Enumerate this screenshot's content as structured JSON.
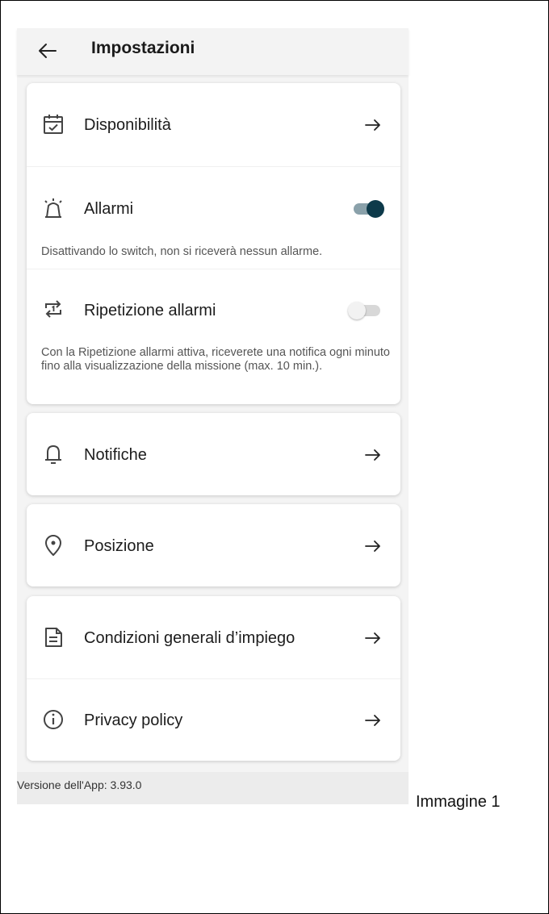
{
  "header": {
    "title": "Impostazioni",
    "back_icon": "arrow-left-icon"
  },
  "settings": {
    "availability": {
      "label": "Disponibilità",
      "icon": "calendar-check-icon"
    },
    "alarms": {
      "label": "Allarmi",
      "icon": "alarm-icon",
      "enabled": true,
      "description": "Disattivando lo switch, non si riceverà nessun allarme."
    },
    "alarm_repeat": {
      "label": "Ripetizione allarmi",
      "icon": "repeat-one-icon",
      "enabled": false,
      "description": "Con la Ripetizione allarmi attiva, riceverete una notifica ogni minuto fino alla visualizzazione della missione (max. 10 min.)."
    },
    "notifications": {
      "label": "Notifiche",
      "icon": "bell-icon"
    },
    "position": {
      "label": "Posizione",
      "icon": "location-pin-icon"
    },
    "terms": {
      "label": "Condizioni generali d’impiego",
      "icon": "document-icon"
    },
    "privacy": {
      "label": "Privacy policy",
      "icon": "info-icon"
    }
  },
  "footer": {
    "version_text": "Versione dell'App: 3.93.0"
  },
  "caption": "Immagine 1",
  "colors": {
    "toggle_on_thumb": "#0d3a4a",
    "toggle_on_track": "#8aa1aa",
    "toggle_off_thumb": "#f2f2f2",
    "toggle_off_track": "#d8d8d8"
  }
}
